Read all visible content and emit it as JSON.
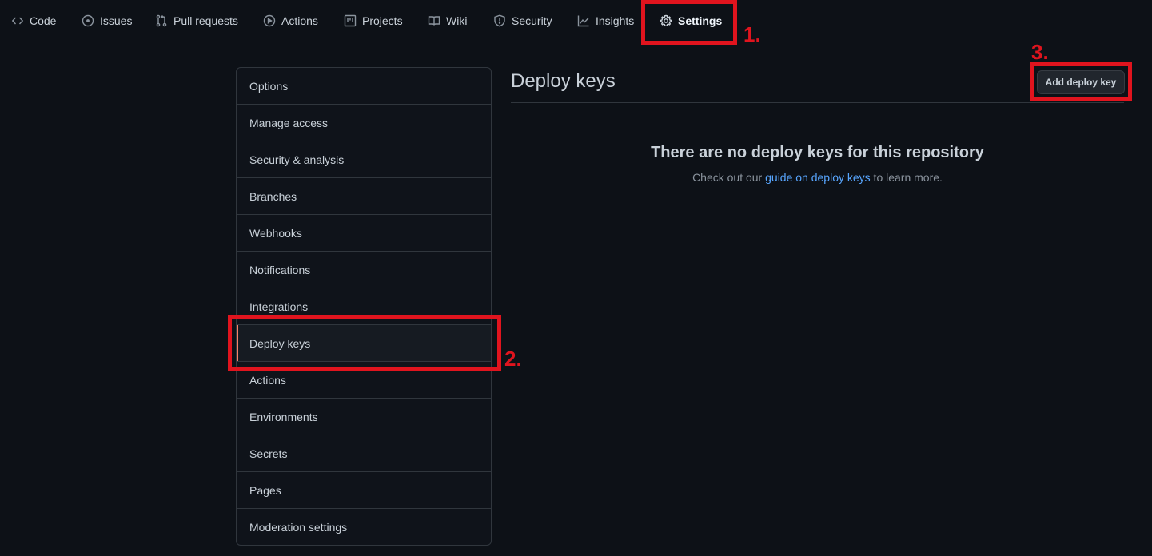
{
  "nav": {
    "tabs": [
      {
        "label": "Code",
        "icon": "code-icon"
      },
      {
        "label": "Issues",
        "icon": "issue-icon"
      },
      {
        "label": "Pull requests",
        "icon": "pull-request-icon"
      },
      {
        "label": "Actions",
        "icon": "play-icon"
      },
      {
        "label": "Projects",
        "icon": "project-icon"
      },
      {
        "label": "Wiki",
        "icon": "book-icon"
      },
      {
        "label": "Security",
        "icon": "shield-icon"
      },
      {
        "label": "Insights",
        "icon": "graph-icon"
      },
      {
        "label": "Settings",
        "icon": "gear-icon",
        "active": true
      }
    ]
  },
  "sidebar": {
    "items": [
      {
        "label": "Options"
      },
      {
        "label": "Manage access"
      },
      {
        "label": "Security & analysis"
      },
      {
        "label": "Branches"
      },
      {
        "label": "Webhooks"
      },
      {
        "label": "Notifications"
      },
      {
        "label": "Integrations"
      },
      {
        "label": "Deploy keys",
        "selected": true
      },
      {
        "label": "Actions"
      },
      {
        "label": "Environments"
      },
      {
        "label": "Secrets"
      },
      {
        "label": "Pages"
      },
      {
        "label": "Moderation settings"
      }
    ]
  },
  "main": {
    "title": "Deploy keys",
    "add_button": "Add deploy key",
    "blankslate_title": "There are no deploy keys for this repository",
    "blankslate_prefix": "Check out our ",
    "blankslate_link": "guide on deploy keys",
    "blankslate_suffix": " to learn more."
  },
  "annotations": {
    "step1": "1.",
    "step2": "2.",
    "step3": "3.",
    "color": "#e0141e"
  }
}
